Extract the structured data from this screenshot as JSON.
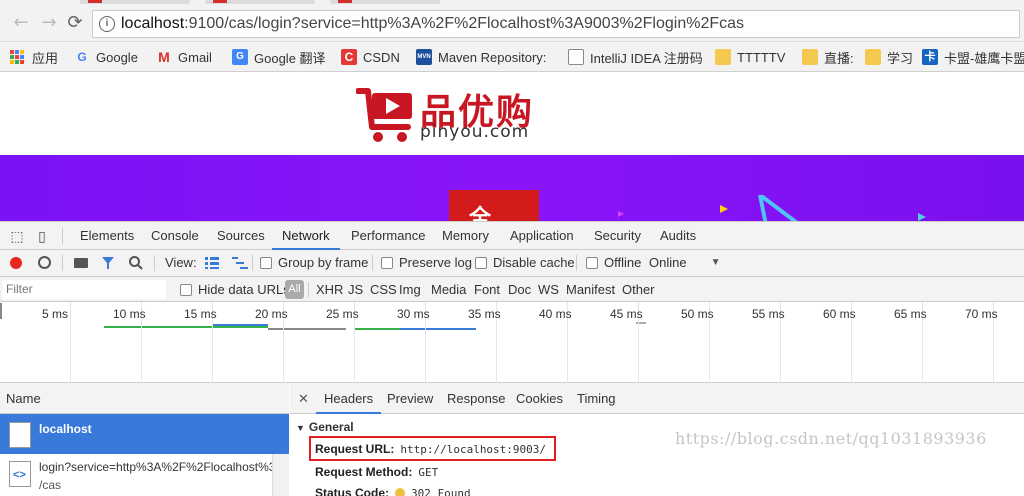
{
  "browser": {
    "address": {
      "host": "localhost",
      "rest": ":9100/cas/login?service=http%3A%2F%2Flocalhost%3A9003%2Flogin%2Fcas"
    },
    "bookmarks": [
      {
        "label": "应用"
      },
      {
        "label": "Google"
      },
      {
        "label": "Gmail"
      },
      {
        "label": "Google 翻译"
      },
      {
        "label": "CSDN"
      },
      {
        "label": "Maven Repository:"
      },
      {
        "label": "IntelliJ IDEA 注册码"
      },
      {
        "label": "TTTTTV"
      },
      {
        "label": "直播:"
      },
      {
        "label": "学习"
      },
      {
        "label": "卡盟-雄鹰卡盟"
      }
    ],
    "colors": {
      "accent": "#3879d9",
      "brand": "#c81623",
      "banner": "#8a14f8"
    }
  },
  "site": {
    "logo_text": "品优购",
    "logo_sub": "pinyou.com"
  },
  "devtools": {
    "tabs": [
      "Elements",
      "Console",
      "Sources",
      "Network",
      "Performance",
      "Memory",
      "Application",
      "Security",
      "Audits"
    ],
    "active_tab": "Network",
    "controls": {
      "view_label": "View:",
      "group_by_frame": "Group by frame",
      "preserve_log": "Preserve log",
      "disable_cache": "Disable cache",
      "offline": "Offline",
      "throttle": "Online"
    },
    "filter": {
      "placeholder": "Filter",
      "hide_data_urls": "Hide data URLs",
      "all": "All",
      "types": [
        "XHR",
        "JS",
        "CSS",
        "Img",
        "Media",
        "Font",
        "Doc",
        "WS",
        "Manifest",
        "Other"
      ]
    },
    "timeline_ticks": [
      "5 ms",
      "10 ms",
      "15 ms",
      "20 ms",
      "25 ms",
      "30 ms",
      "35 ms",
      "40 ms",
      "45 ms",
      "50 ms",
      "55 ms",
      "60 ms",
      "65 ms",
      "70 ms"
    ],
    "name_column": "Name",
    "requests": [
      {
        "name": "localhost",
        "sub": ""
      },
      {
        "name": "login?service=http%3A%2F%2Flocalhost%3...",
        "sub": "/cas"
      }
    ],
    "detail_tabs": [
      "Headers",
      "Preview",
      "Response",
      "Cookies",
      "Timing"
    ],
    "active_detail_tab": "Headers",
    "general": {
      "title": "General",
      "request_url_label": "Request URL:",
      "request_url": "http://localhost:9003/",
      "request_method_label": "Request Method:",
      "request_method": "GET",
      "status_code_label": "Status Code:",
      "status_code": "302 Found"
    }
  },
  "watermark": "https://blog.csdn.net/qq1031893936"
}
